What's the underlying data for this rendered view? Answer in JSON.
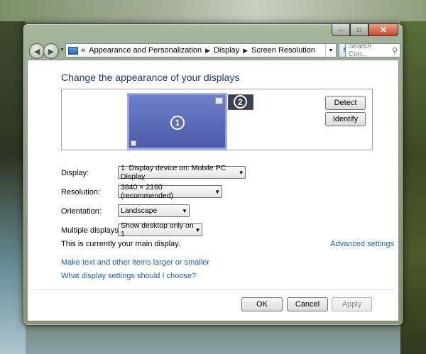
{
  "window": {
    "caption": {
      "minimize": "–",
      "maximize": "□",
      "close": "✕"
    }
  },
  "nav": {
    "back": "◀",
    "forward": "▶",
    "breadcrumb_prefix": "«",
    "breadcrumb": [
      "Appearance and Personalization",
      "Display",
      "Screen Resolution"
    ],
    "search_placeholder": "Search Con..."
  },
  "page": {
    "title": "Change the appearance of your displays"
  },
  "preview": {
    "monitor1_number": "1",
    "monitor2_number": "2",
    "detect_label": "Detect",
    "identify_label": "Identify"
  },
  "settings": {
    "display": {
      "label": "Display:",
      "value": "1. Display device on: Mobile PC Display"
    },
    "resolution": {
      "label": "Resolution:",
      "value": "3840 × 2160 (recommended)"
    },
    "orientation": {
      "label": "Orientation:",
      "value": "Landscape"
    },
    "multiple_displays": {
      "label": "Multiple displays:",
      "value": "Show desktop only on 1"
    }
  },
  "status": {
    "main_display": "This is currently your main display.",
    "advanced_settings": "Advanced settings"
  },
  "links": {
    "text_size": "Make text and other items larger or smaller",
    "which_settings": "What display settings should I choose?"
  },
  "buttons": {
    "ok": "OK",
    "cancel": "Cancel",
    "apply": "Apply"
  }
}
